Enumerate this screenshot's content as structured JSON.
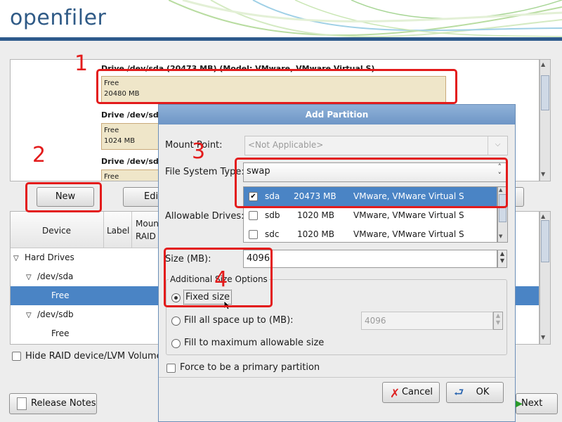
{
  "app": {
    "logo": "openfiler"
  },
  "drives_panel": {
    "drives": [
      {
        "title": "Drive /dev/sda (20473 MB) (Model: VMware, VMware Virtual S)",
        "segment_label": "Free",
        "segment_size": "20480 MB"
      },
      {
        "title": "Drive /dev/sdb",
        "segment_label": "Free",
        "segment_size": "1024 MB"
      },
      {
        "title": "Drive /dev/sdc",
        "segment_label": "Free",
        "segment_size": ""
      }
    ]
  },
  "actions": {
    "new_label": "New",
    "edit_label": "Edit"
  },
  "device_tree": {
    "columns": {
      "device": "Device",
      "label": "Label",
      "mount_line1": "Moun",
      "mount_line2": "RAID"
    },
    "rows": [
      {
        "label": "Hard Drives",
        "expanded": true
      },
      {
        "label": "/dev/sda",
        "expanded": true
      },
      {
        "label": "Free",
        "selected": true
      },
      {
        "label": "/dev/sdb",
        "expanded": true
      },
      {
        "label": "Free"
      }
    ]
  },
  "hide_raid_label": "Hide RAID device/LVM Volume",
  "footer": {
    "release_notes_label": "Release Notes",
    "next_label": "Next"
  },
  "dialog": {
    "title": "Add Partition",
    "mount_point": {
      "label": "Mount Point:",
      "value": "<Not Applicable>"
    },
    "fs_type": {
      "label": "File System Type:",
      "value": "swap"
    },
    "allowable_drives": {
      "label": "Allowable Drives:",
      "rows": [
        {
          "checked": true,
          "name": "sda",
          "size": "20473 MB",
          "model": "VMware, VMware Virtual S"
        },
        {
          "checked": false,
          "name": "sdb",
          "size": "1020 MB",
          "model": "VMware, VMware Virtual S"
        },
        {
          "checked": false,
          "name": "sdc",
          "size": "1020 MB",
          "model": "VMware, VMware Virtual S"
        }
      ]
    },
    "size": {
      "label": "Size (MB):",
      "value": "4096"
    },
    "additional": {
      "legend": "Additional Size Options",
      "fixed_label": "Fixed size",
      "fill_upto_label": "Fill all space up to (MB):",
      "fill_upto_value": "4096",
      "fill_max_label": "Fill to maximum allowable size",
      "selected": "fixed"
    },
    "primary_label": "Force to be a primary partition",
    "cancel_label": "Cancel",
    "ok_label": "OK"
  },
  "annotations": [
    "1",
    "2",
    "3",
    "4"
  ],
  "colors": {
    "annotation": "#e31b1b",
    "selection": "#4a84c5",
    "brand": "#2f5a86"
  },
  "icons": [
    "caret-down-icon",
    "checkbox-checked-icon",
    "radio-selected-icon",
    "cancel-icon",
    "ok-icon",
    "release-notes-icon",
    "next-arrow-icon",
    "mouse-cursor-icon"
  ]
}
